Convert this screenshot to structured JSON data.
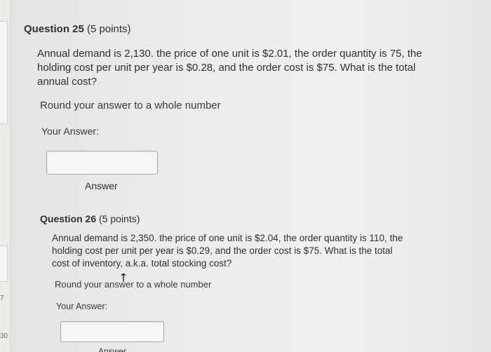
{
  "sidebar": {
    "numbers": [
      "7",
      "30"
    ]
  },
  "question25": {
    "title": "Question 25",
    "points": " (5 points)",
    "text_lines": [
      "Annual demand is 2,130. the price of one unit is $2.01, the order quantity is 75, the",
      "holding cost per unit per year is $0.28, and the order cost is $75. What is the total",
      "annual cost?"
    ],
    "instruction": "Round your answer to a whole number",
    "answer_label": "Your Answer:",
    "answer_value": "",
    "answer_caption": "Answer"
  },
  "question26": {
    "title": "Question 26",
    "points": " (5 points)",
    "text_lines": [
      "Annual demand is 2,350. the price of one unit is $2.04, the order quantity is 110, the",
      "holding cost per unit per year is $0.29, and the order cost is $75. What is the total",
      "cost of inventory, a.k.a. total stocking cost?"
    ],
    "instruction": "Round your answer to a whole number",
    "answer_label": "Your Answer:",
    "answer_value": "",
    "answer_caption": "Answer"
  }
}
